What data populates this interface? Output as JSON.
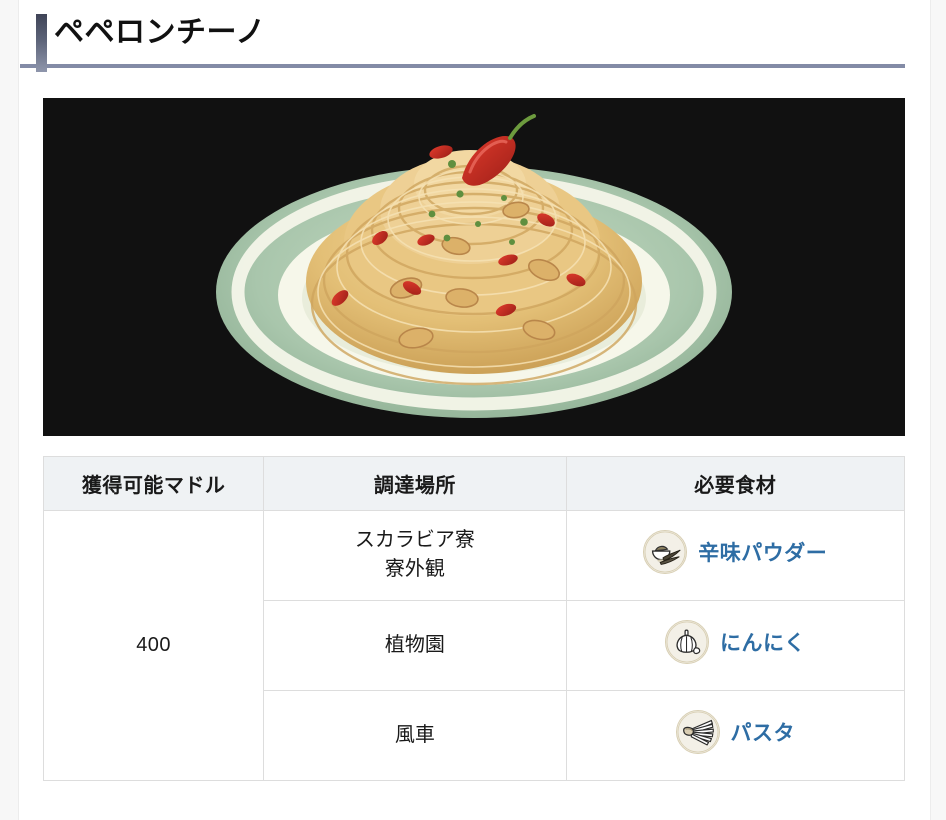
{
  "page": {
    "title": "ペペロンチーノ"
  },
  "dish_image": {
    "alt": "ペペロンチーノのイラスト",
    "background_color": "#111111",
    "plate_color": "#a8c4ab",
    "plate_rim_color": "#f3f4e6",
    "pasta_color": "#e4c07a",
    "chili_color": "#c42b24",
    "herb_color": "#5f8f3f"
  },
  "table": {
    "headers": [
      {
        "id": "madol",
        "label": "獲得可能マドル"
      },
      {
        "id": "place",
        "label": "調達場所"
      },
      {
        "id": "materials",
        "label": "必要食材"
      }
    ],
    "madol_value": "400",
    "rows": [
      {
        "place_lines": [
          "スカラビア寮",
          "寮外観"
        ],
        "material": {
          "name": "辛味パウダー",
          "icon": "chili-powder-icon"
        }
      },
      {
        "place_lines": [
          "植物園"
        ],
        "material": {
          "name": "にんにく",
          "icon": "garlic-icon"
        }
      },
      {
        "place_lines": [
          "風車"
        ],
        "material": {
          "name": "パスタ",
          "icon": "pasta-icon"
        }
      }
    ]
  },
  "colors": {
    "heading_rule": "#838ba6",
    "heading_bar_top": "#3f4457",
    "heading_bar_bottom": "#8f96ac",
    "table_header_bg": "#eff2f4",
    "table_border": "#dddddd",
    "link": "#2e6da4",
    "icon_bg": "#f3f0e7",
    "icon_border": "#d8cfb4"
  }
}
